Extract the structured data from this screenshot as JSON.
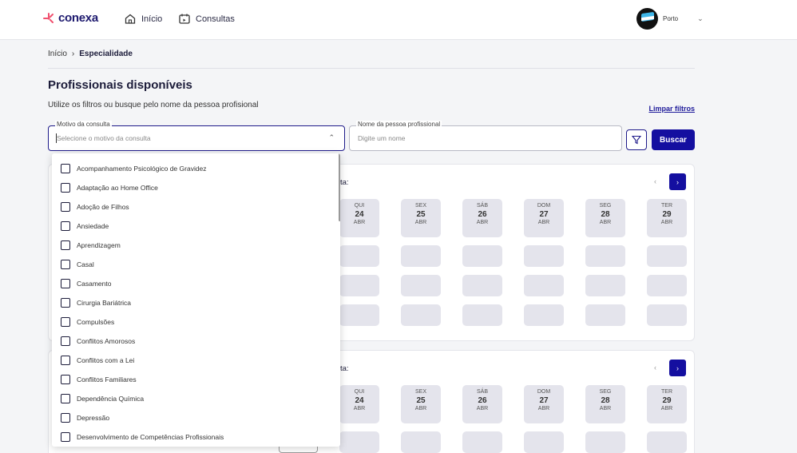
{
  "header": {
    "logo": "conexa",
    "nav": [
      {
        "label": "Início",
        "icon": "home-icon"
      },
      {
        "label": "Consultas",
        "icon": "calendar-icon"
      }
    ],
    "user": {
      "name": "Porto"
    }
  },
  "breadcrumb": {
    "home": "Início",
    "separator": "›",
    "current": "Especialidade"
  },
  "page": {
    "title": "Profissionais disponíveis",
    "subtitle": "Utilize os filtros ou busque pelo nome da pessoa profisional",
    "clear_filters": "Limpar filtros"
  },
  "filters": {
    "motivo": {
      "label": "Motivo da consulta",
      "placeholder": "Selecione o motivo da consulta"
    },
    "nome": {
      "label": "Nome da pessoa profissional",
      "placeholder": "Digite um nome"
    },
    "search_label": "Buscar"
  },
  "dropdown": {
    "items": [
      "Acompanhamento Psicológico de Gravidez",
      "Adaptação ao Home Office",
      "Adoção de Filhos",
      "Ansiedade",
      "Aprendizagem",
      "Casal",
      "Casamento",
      "Cirurgia Bariátrica",
      "Compulsões",
      "Conflitos Amorosos",
      "Conflitos com a Lei",
      "Conflitos Familiares",
      "Dependência Química",
      "Depressão",
      "Desenvolvimento de Competências Profissionais"
    ]
  },
  "cards": [
    {
      "heading": "ta:",
      "prev": "‹",
      "next": "›"
    },
    {
      "heading": "ta:",
      "prev": "‹",
      "next": "›"
    }
  ],
  "days": [
    {
      "weekday": "QUI",
      "day": "24",
      "month": "ABR"
    },
    {
      "weekday": "SEX",
      "day": "25",
      "month": "ABR"
    },
    {
      "weekday": "SÁB",
      "day": "26",
      "month": "ABR"
    },
    {
      "weekday": "DOM",
      "day": "27",
      "month": "ABR"
    },
    {
      "weekday": "SEG",
      "day": "28",
      "month": "ABR"
    },
    {
      "weekday": "TER",
      "day": "29",
      "month": "ABR"
    }
  ],
  "colors": {
    "primary": "#140fa0",
    "logo_accent": "#f0506e"
  }
}
